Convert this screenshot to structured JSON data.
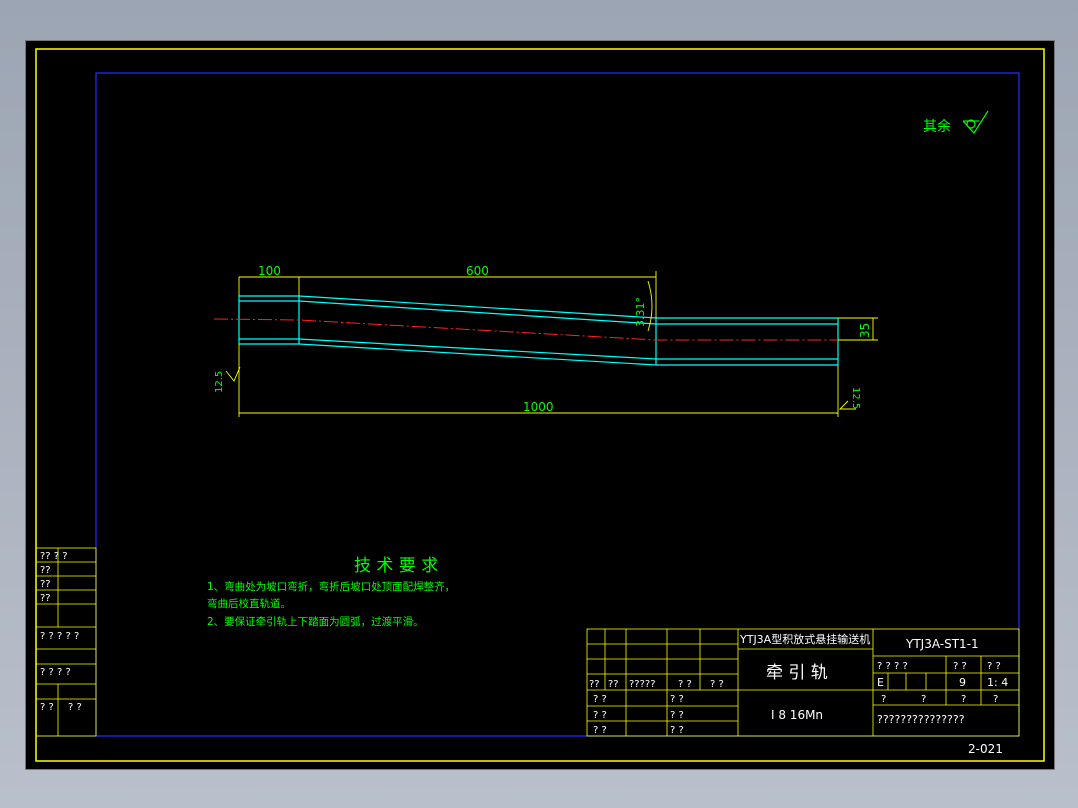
{
  "roughness": {
    "label": "其余"
  },
  "dimensions": {
    "d100": "100",
    "d600": "600",
    "angle": "3.31°",
    "d35": "35",
    "d1000": "1000",
    "rough_left": "12.5",
    "rough_right": "12.5"
  },
  "requirements": {
    "heading": "技 术 要 求",
    "line1": "1、弯曲处为坡口弯折，弯折后坡口处顶面配焊整齐，",
    "line2": "弯曲后校直轨道。",
    "line3": "2、要保证牵引轨上下踏面为圆弧，过渡平滑。"
  },
  "title_block": {
    "company": "YTJ3A型积放式悬挂输送机",
    "drawing_no": "YTJ3A-ST1-1",
    "part_name": "牵 引 轨",
    "material": "I 8  16Mn",
    "hdr1": "? ? ? ?",
    "hdr2": "? ?",
    "hdr3": "? ?",
    "stage": "E",
    "weight": "9",
    "scale": "1: 4",
    "r4a": "?",
    "r4b": "?",
    "r4c": "?",
    "r4d": "?",
    "owner": "???????????????",
    "rev1": "??",
    "rev2": "??",
    "rev3": "?????",
    "rev4": "? ?",
    "rev5": "? ?",
    "sign1": "? ?",
    "sign2": "? ?",
    "sign3": "? ?",
    "sign4": "? ?",
    "sign5": "? ?",
    "sign6": "? ?",
    "sign7": "? ?",
    "sign8": "? ?"
  },
  "side_block": {
    "s1": "?? ? ?",
    "s2": "??",
    "s3": "??",
    "s4": "??",
    "s5": "? ? ? ? ?",
    "s6": "? ? ? ?",
    "s7": "? ?",
    "s8": "? ?"
  },
  "sheet_no": "2-021"
}
